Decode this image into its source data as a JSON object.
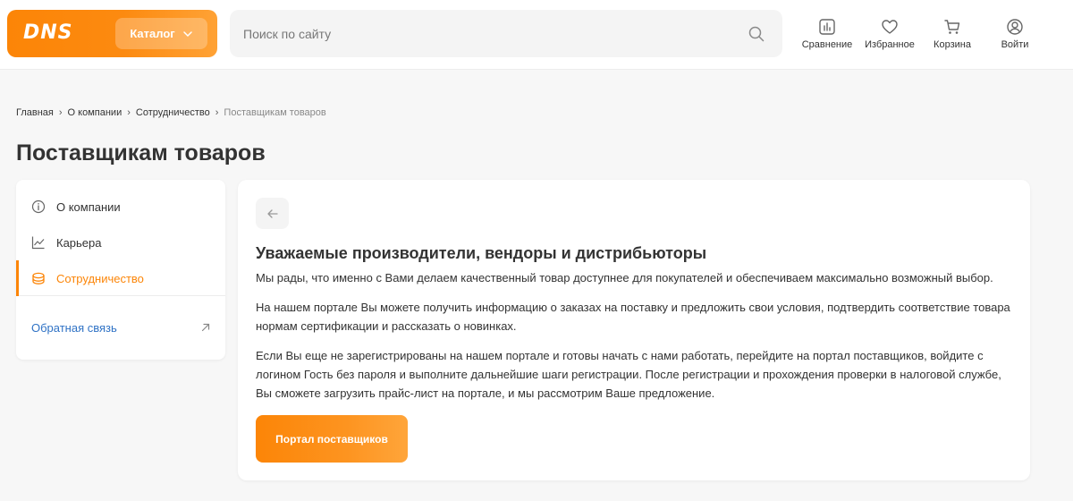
{
  "header": {
    "logo": "DNS",
    "catalog_label": "Каталог",
    "search_placeholder": "Поиск по сайту",
    "actions": [
      {
        "label": "Сравнение",
        "icon": "chart-icon"
      },
      {
        "label": "Избранное",
        "icon": "heart-icon"
      },
      {
        "label": "Корзина",
        "icon": "cart-icon"
      },
      {
        "label": "Войти",
        "icon": "user-icon"
      }
    ]
  },
  "breadcrumb": [
    "Главная",
    "О компании",
    "Сотрудничество",
    "Поставщикам товаров"
  ],
  "page_title": "Поставщикам товаров",
  "sidebar": {
    "items": [
      {
        "label": "О компании",
        "icon": "info-icon",
        "active": false
      },
      {
        "label": "Карьера",
        "icon": "trend-icon",
        "active": false
      },
      {
        "label": "Сотрудничество",
        "icon": "stack-icon",
        "active": true
      }
    ],
    "feedback_label": "Обратная связь"
  },
  "content": {
    "heading": "Уважаемые производители, вендоры и дистрибьюторы",
    "p1": "Мы рады, что именно с Вами делаем качественный товар доступнее для покупателей и обеспечиваем максимально возможный выбор.",
    "p2": "На нашем портале Вы можете получить информацию о заказах на поставку и предложить свои условия, подтвердить соответствие товара нормам сертификации и рассказать о новинках.",
    "p3": "Если Вы еще не зарегистрированы на нашем портале и готовы начать с нами работать, перейдите на портал поставщиков, войдите с логином Гость без пароля и выполните дальнейшие шаги регистрации. После регистрации и прохождения проверки в налоговой службе, Вы сможете загрузить прайс-лист на портале, и мы рассмотрим Ваше предложение.",
    "button_label": "Портал поставщиков"
  },
  "colors": {
    "accent": "#fc8507",
    "link": "#2f72c5",
    "background": "#f7f7f7"
  }
}
